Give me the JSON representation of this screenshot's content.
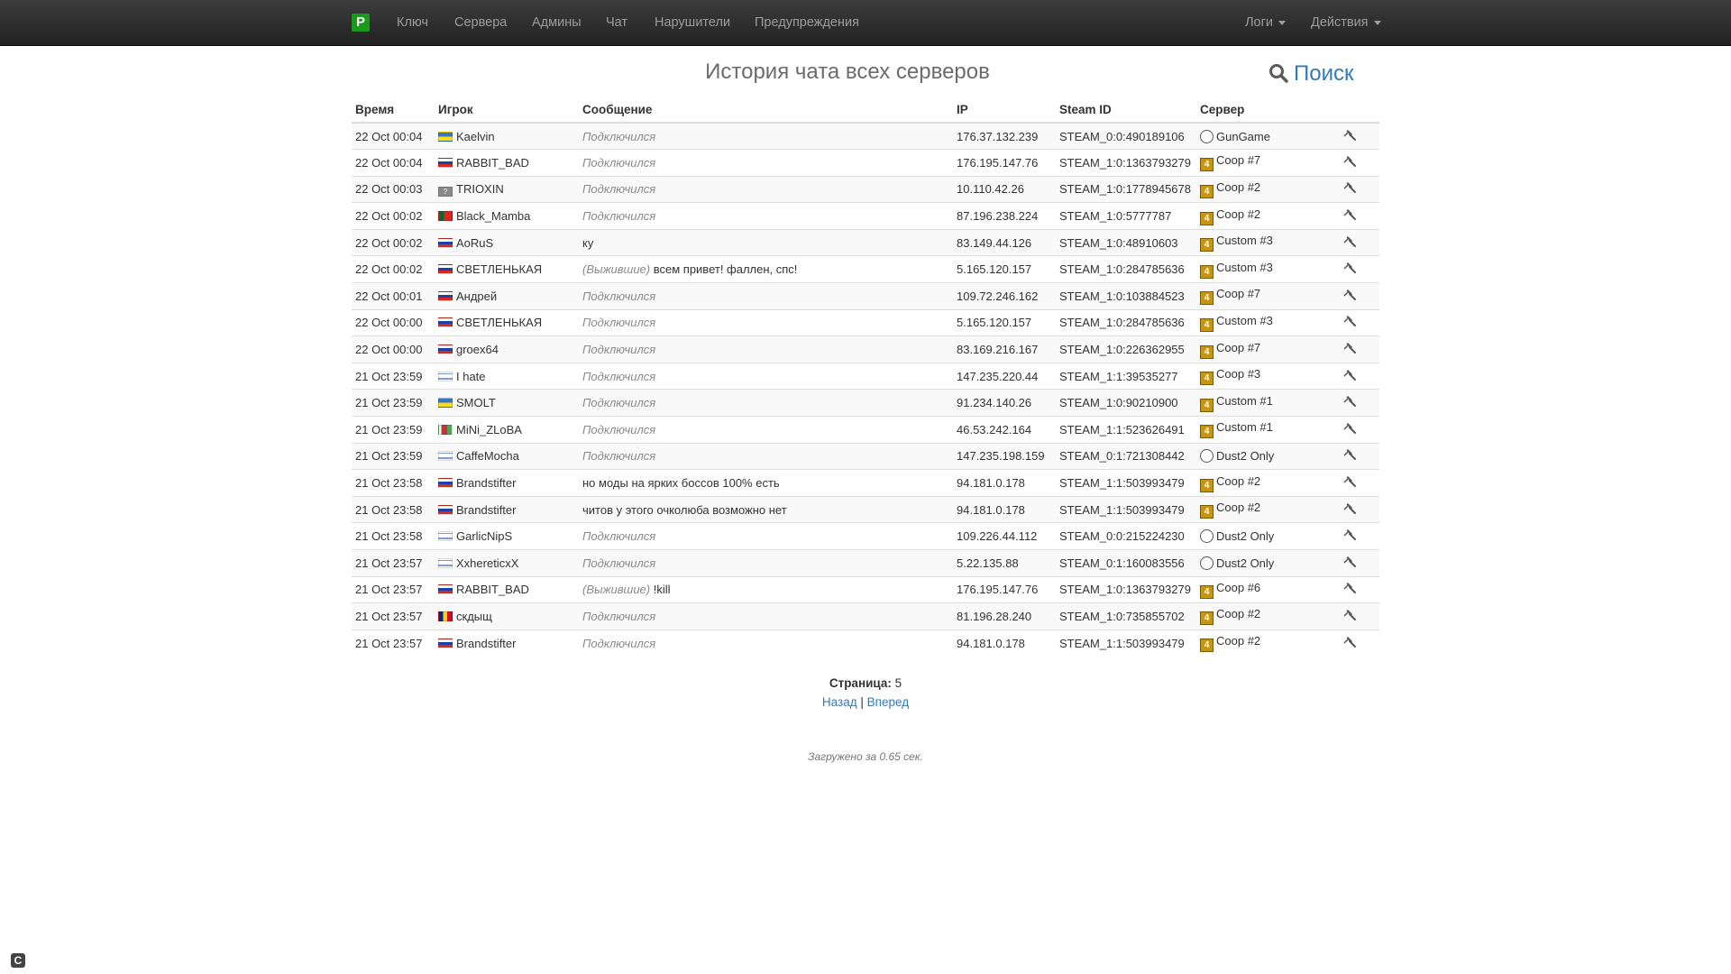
{
  "nav": {
    "brand": "P",
    "items": [
      "Ключ",
      "Сервера",
      "Админы",
      "Чат",
      "Нарушители",
      "Предупреждения"
    ],
    "logs_label": "Логи",
    "actions_label": "Действия"
  },
  "page": {
    "title": "История чата всех серверов",
    "search_label": "Поиск"
  },
  "table": {
    "headers": [
      "Время",
      "Игрок",
      "Сообщение",
      "IP",
      "Steam ID",
      "Сервер"
    ],
    "rows": [
      {
        "time": "22 Oct 00:04",
        "flag": "ua",
        "player": "Kaelvin",
        "prefix": "",
        "msg": "Подключился",
        "status": true,
        "ip": "176.37.132.239",
        "steam": "STEAM_0:0:490189106",
        "game": "cs",
        "server": "GunGame"
      },
      {
        "time": "22 Oct 00:04",
        "flag": "ru",
        "player": "RABBIT_BAD",
        "prefix": "",
        "msg": "Подключился",
        "status": true,
        "ip": "176.195.147.76",
        "steam": "STEAM_1:0:1363793279",
        "game": "l4d",
        "server": "Coop #7"
      },
      {
        "time": "22 Oct 00:03",
        "flag": "unknown",
        "player": "TRIOXIN",
        "prefix": "",
        "msg": "Подключился",
        "status": true,
        "ip": "10.110.42.26",
        "steam": "STEAM_1:0:1778945678",
        "game": "l4d",
        "server": "Coop #2"
      },
      {
        "time": "22 Oct 00:02",
        "flag": "pt",
        "player": "Black_Mamba",
        "prefix": "",
        "msg": "Подключился",
        "status": true,
        "ip": "87.196.238.224",
        "steam": "STEAM_1:0:5777787",
        "game": "l4d",
        "server": "Coop #2"
      },
      {
        "time": "22 Oct 00:02",
        "flag": "ru",
        "player": "AoRuS",
        "prefix": "",
        "msg": "ку",
        "status": false,
        "ip": "83.149.44.126",
        "steam": "STEAM_1:0:48910603",
        "game": "l4d",
        "server": "Custom #3"
      },
      {
        "time": "22 Oct 00:02",
        "flag": "ru",
        "player": "СВЕТЛЕНЬКАЯ",
        "prefix": "(Выжившие)",
        "msg": "всем привет! фаллен, спс!",
        "status": false,
        "ip": "5.165.120.157",
        "steam": "STEAM_1:0:284785636",
        "game": "l4d",
        "server": "Custom #3"
      },
      {
        "time": "22 Oct 00:01",
        "flag": "ru",
        "player": "Андрей",
        "prefix": "",
        "msg": "Подключился",
        "status": true,
        "ip": "109.72.246.162",
        "steam": "STEAM_1:0:103884523",
        "game": "l4d",
        "server": "Coop #7"
      },
      {
        "time": "22 Oct 00:00",
        "flag": "ru",
        "player": "СВЕТЛЕНЬКАЯ",
        "prefix": "",
        "msg": "Подключился",
        "status": true,
        "ip": "5.165.120.157",
        "steam": "STEAM_1:0:284785636",
        "game": "l4d",
        "server": "Custom #3"
      },
      {
        "time": "22 Oct 00:00",
        "flag": "ru",
        "player": "groex64",
        "prefix": "",
        "msg": "Подключился",
        "status": true,
        "ip": "83.169.216.167",
        "steam": "STEAM_1:0:226362955",
        "game": "l4d",
        "server": "Coop #7"
      },
      {
        "time": "21 Oct 23:59",
        "flag": "il",
        "player": "I hate",
        "prefix": "",
        "msg": "Подключился",
        "status": true,
        "ip": "147.235.220.44",
        "steam": "STEAM_1:1:39535277",
        "game": "l4d",
        "server": "Coop #3"
      },
      {
        "time": "21 Oct 23:59",
        "flag": "ua",
        "player": "SMOLT",
        "prefix": "",
        "msg": "Подключился",
        "status": true,
        "ip": "91.234.140.26",
        "steam": "STEAM_1:0:90210900",
        "game": "l4d",
        "server": "Custom #1"
      },
      {
        "time": "21 Oct 23:59",
        "flag": "by",
        "player": "MiNi_ZLoBA",
        "prefix": "",
        "msg": "Подключился",
        "status": true,
        "ip": "46.53.242.164",
        "steam": "STEAM_1:1:523626491",
        "game": "l4d",
        "server": "Custom #1"
      },
      {
        "time": "21 Oct 23:59",
        "flag": "il",
        "player": "CaffeMocha",
        "prefix": "",
        "msg": "Подключился",
        "status": true,
        "ip": "147.235.198.159",
        "steam": "STEAM_0:1:721308442",
        "game": "cs",
        "server": "Dust2 Only"
      },
      {
        "time": "21 Oct 23:58",
        "flag": "ru",
        "player": "Brandstifter",
        "prefix": "",
        "msg": "но моды на ярких боссов 100% есть",
        "status": false,
        "ip": "94.181.0.178",
        "steam": "STEAM_1:1:503993479",
        "game": "l4d",
        "server": "Coop #2"
      },
      {
        "time": "21 Oct 23:58",
        "flag": "ru",
        "player": "Brandstifter",
        "prefix": "",
        "msg": "читов у этого очколюба возможно нет",
        "status": false,
        "ip": "94.181.0.178",
        "steam": "STEAM_1:1:503993479",
        "game": "l4d",
        "server": "Coop #2"
      },
      {
        "time": "21 Oct 23:58",
        "flag": "il",
        "player": "GarlicNipS",
        "prefix": "",
        "msg": "Подключился",
        "status": true,
        "ip": "109.226.44.112",
        "steam": "STEAM_0:0:215224230",
        "game": "cs",
        "server": "Dust2 Only"
      },
      {
        "time": "21 Oct 23:57",
        "flag": "il",
        "player": "XxhereticxX",
        "prefix": "",
        "msg": "Подключился",
        "status": true,
        "ip": "5.22.135.88",
        "steam": "STEAM_0:1:160083556",
        "game": "cs",
        "server": "Dust2 Only"
      },
      {
        "time": "21 Oct 23:57",
        "flag": "ru",
        "player": "RABBIT_BAD",
        "prefix": "(Выжившие)",
        "msg": "!kill",
        "status": false,
        "ip": "176.195.147.76",
        "steam": "STEAM_1:0:1363793279",
        "game": "l4d",
        "server": "Coop #6"
      },
      {
        "time": "21 Oct 23:57",
        "flag": "ro",
        "player": "скдыщ",
        "prefix": "",
        "msg": "Подключился",
        "status": true,
        "ip": "81.196.28.240",
        "steam": "STEAM_1:0:735855702",
        "game": "l4d",
        "server": "Coop #2"
      },
      {
        "time": "21 Oct 23:57",
        "flag": "ru",
        "player": "Brandstifter",
        "prefix": "",
        "msg": "Подключился",
        "status": true,
        "ip": "94.181.0.178",
        "steam": "STEAM_1:1:503993479",
        "game": "l4d",
        "server": "Coop #2"
      }
    ]
  },
  "pagination": {
    "page_label": "Страница:",
    "page_number": "5",
    "back_label": "Назад",
    "separator": "|",
    "next_label": "Вперед"
  },
  "footer": {
    "loaded_text": "Загружено за 0.65 сек."
  }
}
